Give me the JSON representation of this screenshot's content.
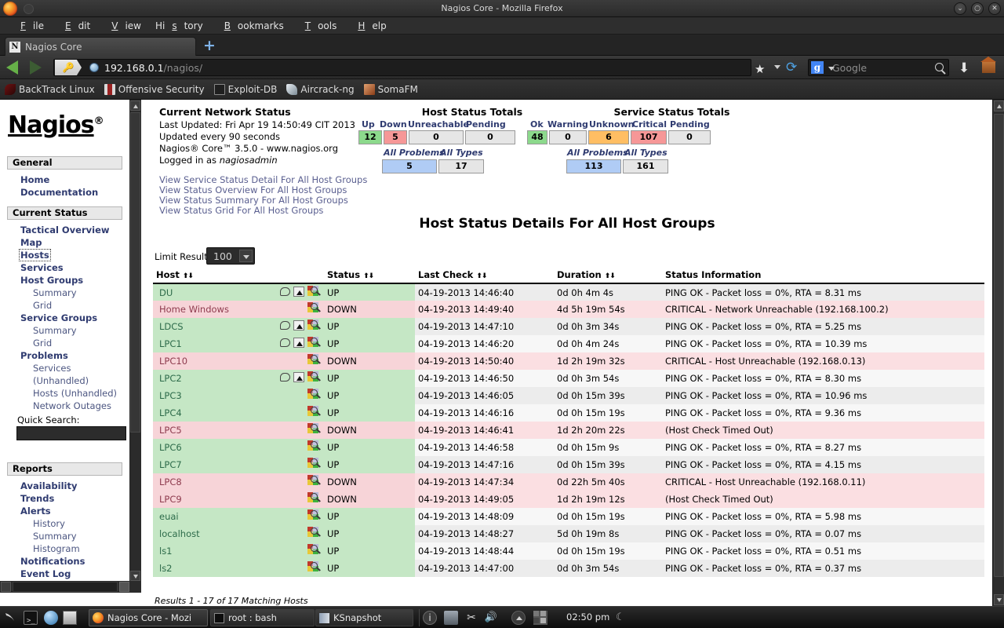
{
  "window": {
    "title": "Nagios Core - Mozilla Firefox",
    "min_label": "⌄",
    "max_label": "○",
    "close_label": "✕"
  },
  "menubar": [
    {
      "label": "File",
      "accel": "F"
    },
    {
      "label": "Edit",
      "accel": "E"
    },
    {
      "label": "View",
      "accel": "V"
    },
    {
      "label": "History",
      "accel": "s"
    },
    {
      "label": "Bookmarks",
      "accel": "B"
    },
    {
      "label": "Tools",
      "accel": "T"
    },
    {
      "label": "Help",
      "accel": "H"
    }
  ],
  "tab": {
    "favicon_letter": "N",
    "label": "Nagios Core",
    "newtab_label": "+"
  },
  "navbar": {
    "back_icon": "back-arrow-icon",
    "forward_icon": "forward-arrow-icon",
    "identity_icon": "key-icon",
    "url_host": "192.168.0.1",
    "url_path": "/nagios/",
    "bookmark_icon": "star-icon",
    "reload_icon": "reload-icon",
    "search_engine": "g-icon",
    "search_placeholder": "Google",
    "search_icon": "magnifier-icon",
    "download_icon": "download-arrow-icon",
    "home_icon": "home-icon"
  },
  "bookmarks": [
    {
      "label": "BackTrack Linux",
      "icon": "backtrack-icon",
      "color": "#7a1b1b"
    },
    {
      "label": "Offensive Security",
      "icon": "offsec-icon",
      "color": "#9b2222"
    },
    {
      "label": "Exploit-DB",
      "icon": "exploitdb-icon",
      "color": "#cfcfcf"
    },
    {
      "label": "Aircrack-ng",
      "icon": "aircrack-icon",
      "color": "#a9b3bb"
    },
    {
      "label": "SomaFM",
      "icon": "somafm-icon",
      "color": "#c06a3b"
    }
  ],
  "sidebar": {
    "logo": "Nagios",
    "logo_sup": "®",
    "sections": [
      {
        "header": "General",
        "items": [
          {
            "label": "Home",
            "level": 1,
            "focused": false
          },
          {
            "label": "Documentation",
            "level": 1,
            "focused": false
          }
        ]
      },
      {
        "header": "Current Status",
        "items": [
          {
            "label": "Tactical Overview",
            "level": 1,
            "focused": false
          },
          {
            "label": "Map",
            "level": 1,
            "focused": false
          },
          {
            "label": "Hosts",
            "level": 1,
            "focused": true
          },
          {
            "label": "Services",
            "level": 1,
            "focused": false
          },
          {
            "label": "Host Groups",
            "level": 1,
            "focused": false
          },
          {
            "label": "Summary",
            "level": 2,
            "focused": false
          },
          {
            "label": "Grid",
            "level": 2,
            "focused": false
          },
          {
            "label": "Service Groups",
            "level": 1,
            "focused": false
          },
          {
            "label": "Summary",
            "level": 2,
            "focused": false
          },
          {
            "label": "Grid",
            "level": 2,
            "focused": false
          },
          {
            "label": "Problems",
            "level": 1,
            "focused": false
          },
          {
            "label": "Services",
            "level": 2,
            "focused": false
          },
          {
            "label": "(Unhandled)",
            "level": 2,
            "focused": false
          },
          {
            "label": "Hosts (Unhandled)",
            "level": 2,
            "focused": false
          },
          {
            "label": "Network Outages",
            "level": 2,
            "focused": false
          }
        ]
      },
      {
        "header": "Reports",
        "items": [
          {
            "label": "Availability",
            "level": 1,
            "focused": false
          },
          {
            "label": "Trends",
            "level": 1,
            "focused": false
          },
          {
            "label": "Alerts",
            "level": 1,
            "focused": false
          },
          {
            "label": "History",
            "level": 2,
            "focused": false
          },
          {
            "label": "Summary",
            "level": 2,
            "focused": false
          },
          {
            "label": "Histogram",
            "level": 2,
            "focused": false
          },
          {
            "label": "Notifications",
            "level": 1,
            "focused": false
          },
          {
            "label": "Event Log",
            "level": 1,
            "focused": false
          }
        ]
      }
    ],
    "quick_search_label": "Quick Search:",
    "quick_search_value": ""
  },
  "network_status": {
    "title": "Current Network Status",
    "last_updated": "Last Updated: Fri Apr 19 14:50:49 CIT 2013",
    "update_interval": "Updated every 90 seconds",
    "version": "Nagios® Core™ 3.5.0 - www.nagios.org",
    "logged_in_prefix": "Logged in as ",
    "logged_in_user": "nagiosadmin",
    "links": [
      "View Service Status Detail For All Host Groups",
      "View Status Overview For All Host Groups",
      "View Status Summary For All Host Groups",
      "View Status Grid For All Host Groups"
    ]
  },
  "host_totals": {
    "title": "Host Status Totals",
    "columns": [
      "Up",
      "Down",
      "Unreachable",
      "Pending"
    ],
    "values": [
      "12",
      "5",
      "0",
      "0"
    ],
    "all_problems_label": "All Problems",
    "all_types_label": "All Types",
    "all_problems": "5",
    "all_types": "17"
  },
  "service_totals": {
    "title": "Service Status Totals",
    "columns": [
      "Ok",
      "Warning",
      "Unknown",
      "Critical",
      "Pending"
    ],
    "values": [
      "48",
      "0",
      "6",
      "107",
      "0"
    ],
    "all_problems_label": "All Problems",
    "all_types_label": "All Types",
    "all_problems": "113",
    "all_types": "161"
  },
  "main": {
    "page_title": "Host Status Details For All Host Groups",
    "limit_label": "Limit Results:",
    "limit_value": "100",
    "results_line": "Results 1 - 17 of 17 Matching Hosts"
  },
  "table": {
    "headers": [
      "Host",
      "Status",
      "Last Check",
      "Duration",
      "Status Information"
    ],
    "sort_icons": "⬆⬇",
    "rows": [
      {
        "host": "DU",
        "status": "UP",
        "last_check": "04-19-2013 14:46:40",
        "duration": "0d 0h 4m 4s",
        "info": "PING OK - Packet loss = 0%, RTA = 8.31 ms",
        "icons": [
          "comment",
          "ack",
          "detail"
        ]
      },
      {
        "host": "Home Windows",
        "status": "DOWN",
        "last_check": "04-19-2013 14:49:40",
        "duration": "4d 5h 19m 54s",
        "info": "CRITICAL - Network Unreachable (192.168.100.2)",
        "icons": [
          "detail"
        ]
      },
      {
        "host": "LDCS",
        "status": "UP",
        "last_check": "04-19-2013 14:47:10",
        "duration": "0d 0h 3m 34s",
        "info": "PING OK - Packet loss = 0%, RTA = 5.25 ms",
        "icons": [
          "comment",
          "ack",
          "detail"
        ]
      },
      {
        "host": "LPC1",
        "status": "UP",
        "last_check": "04-19-2013 14:46:20",
        "duration": "0d 0h 4m 24s",
        "info": "PING OK - Packet loss = 0%, RTA = 10.39 ms",
        "icons": [
          "comment",
          "ack",
          "detail"
        ]
      },
      {
        "host": "LPC10",
        "status": "DOWN",
        "last_check": "04-19-2013 14:50:40",
        "duration": "1d 2h 19m 32s",
        "info": "CRITICAL - Host Unreachable (192.168.0.13)",
        "icons": [
          "detail"
        ]
      },
      {
        "host": "LPC2",
        "status": "UP",
        "last_check": "04-19-2013 14:46:50",
        "duration": "0d 0h 3m 54s",
        "info": "PING OK - Packet loss = 0%, RTA = 8.30 ms",
        "icons": [
          "comment",
          "ack",
          "detail"
        ]
      },
      {
        "host": "LPC3",
        "status": "UP",
        "last_check": "04-19-2013 14:46:05",
        "duration": "0d 0h 15m 39s",
        "info": "PING OK - Packet loss = 0%, RTA = 10.96 ms",
        "icons": [
          "detail"
        ]
      },
      {
        "host": "LPC4",
        "status": "UP",
        "last_check": "04-19-2013 14:46:16",
        "duration": "0d 0h 15m 19s",
        "info": "PING OK - Packet loss = 0%, RTA = 9.36 ms",
        "icons": [
          "detail"
        ]
      },
      {
        "host": "LPC5",
        "status": "DOWN",
        "last_check": "04-19-2013 14:46:41",
        "duration": "1d 2h 20m 22s",
        "info": "(Host Check Timed Out)",
        "icons": [
          "detail"
        ]
      },
      {
        "host": "LPC6",
        "status": "UP",
        "last_check": "04-19-2013 14:46:58",
        "duration": "0d 0h 15m 9s",
        "info": "PING OK - Packet loss = 0%, RTA = 8.27 ms",
        "icons": [
          "detail"
        ]
      },
      {
        "host": "LPC7",
        "status": "UP",
        "last_check": "04-19-2013 14:47:16",
        "duration": "0d 0h 15m 39s",
        "info": "PING OK - Packet loss = 0%, RTA = 4.15 ms",
        "icons": [
          "detail"
        ]
      },
      {
        "host": "LPC8",
        "status": "DOWN",
        "last_check": "04-19-2013 14:47:34",
        "duration": "0d 22h 5m 40s",
        "info": "CRITICAL - Host Unreachable (192.168.0.11)",
        "icons": [
          "detail"
        ]
      },
      {
        "host": "LPC9",
        "status": "DOWN",
        "last_check": "04-19-2013 14:49:05",
        "duration": "1d 2h 19m 12s",
        "info": "(Host Check Timed Out)",
        "icons": [
          "detail"
        ]
      },
      {
        "host": "euai",
        "status": "UP",
        "last_check": "04-19-2013 14:48:09",
        "duration": "0d 0h 15m 19s",
        "info": "PING OK - Packet loss = 0%, RTA = 5.98 ms",
        "icons": [
          "detail"
        ]
      },
      {
        "host": "localhost",
        "status": "UP",
        "last_check": "04-19-2013 14:48:27",
        "duration": "5d 0h 19m 8s",
        "info": "PING OK - Packet loss = 0%, RTA = 0.07 ms",
        "icons": [
          "detail"
        ]
      },
      {
        "host": "ls1",
        "status": "UP",
        "last_check": "04-19-2013 14:48:44",
        "duration": "0d 0h 15m 19s",
        "info": "PING OK - Packet loss = 0%, RTA = 0.51 ms",
        "icons": [
          "detail"
        ]
      },
      {
        "host": "ls2",
        "status": "UP",
        "last_check": "04-19-2013 14:47:00",
        "duration": "0d 0h 3m 54s",
        "info": "PING OK - Packet loss = 0%, RTA = 0.37 ms",
        "icons": [
          "detail"
        ]
      }
    ]
  },
  "taskbar": {
    "launchers": [
      "dragon-icon",
      "terminal-icon",
      "globe-icon",
      "notes-icon"
    ],
    "tasks": [
      {
        "label": "Nagios Core - Mozi",
        "icon": "firefox-icon",
        "active": true
      },
      {
        "label": "root : bash",
        "icon": "terminal-icon",
        "active": false
      },
      {
        "label": "KSnapshot",
        "icon": "ksnapshot-icon",
        "active": false
      }
    ],
    "tray": [
      "info-icon",
      "display-icon",
      "scissors-icon",
      "volume-icon",
      "up-arrow-icon"
    ],
    "clock": "02:50 pm"
  },
  "colors": {
    "up_bg": "#c5e7c5",
    "down_bg": "#f7d4d8",
    "ok_green": "#8cd98c",
    "critical_red": "#f69797",
    "unknown_orange": "#ffbe63",
    "problem_blue": "#b0ccf5",
    "link_blue": "#2f3b70"
  }
}
